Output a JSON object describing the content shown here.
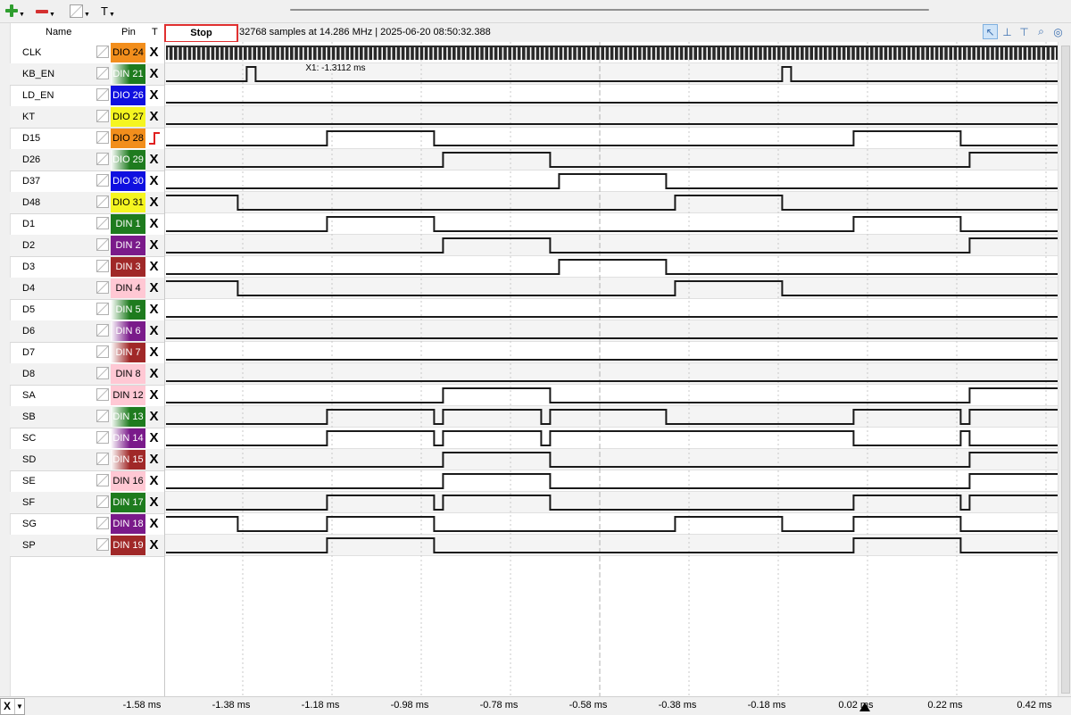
{
  "toolbar": {
    "add_icon": "plus-icon",
    "remove_icon": "minus-icon",
    "decoder_icon": "decoder-icon",
    "text_icon_label": "T"
  },
  "columns": {
    "name": "Name",
    "pin": "Pin",
    "trigger": "T"
  },
  "header": {
    "stop_label": "Stop",
    "info": "32768 samples at 14.286 MHz | 2025-06-20 08:50:32.388"
  },
  "cursor": {
    "label": "X1: -1.3112 ms",
    "time_ms": -1.3112
  },
  "time_axis": {
    "start_ms": -1.58,
    "ms_per_div": 0.2,
    "ticks": [
      "-1.58 ms",
      "-1.38 ms",
      "-1.18 ms",
      "-0.98 ms",
      "-0.78 ms",
      "-0.58 ms",
      "-0.38 ms",
      "-0.18 ms",
      "0.02 ms",
      "0.22 ms",
      "0.42 ms"
    ]
  },
  "x_selector": "X",
  "signals": [
    {
      "name": "CLK",
      "pin": "DIO 24",
      "pin_colors": [
        "#f28e1c",
        "#f28e1c"
      ],
      "pin_text": "#000",
      "trigger": "X",
      "clock": true,
      "init": 1,
      "edges": []
    },
    {
      "name": "KB_EN",
      "pin": "DIN 21",
      "pin_colors": [
        "#ffffff",
        "#1e7b1e"
      ],
      "pin_text": "#fff",
      "trigger": "X",
      "init": 0,
      "edges": [
        -1.3712,
        -1.3512,
        -0.1712,
        -0.1512
      ]
    },
    {
      "name": "LD_EN",
      "pin": "DIO 26",
      "pin_colors": [
        "#1010e0",
        "#1010e0"
      ],
      "pin_text": "#fff",
      "trigger": "X",
      "init": 0,
      "edges": []
    },
    {
      "name": "KT",
      "pin": "DIO 27",
      "pin_colors": [
        "#f5f520",
        "#f5f520"
      ],
      "pin_text": "#000",
      "trigger": "X",
      "init": 0,
      "edges": []
    },
    {
      "name": "D15",
      "pin": "DIO 28",
      "pin_colors": [
        "#f28e1c",
        "#f28e1c"
      ],
      "pin_text": "#000",
      "trigger": "rise",
      "init": 0,
      "edges": [
        -1.1912,
        -0.9512,
        -0.0112,
        0.2288
      ]
    },
    {
      "name": "D26",
      "pin": "DIO 29",
      "pin_colors": [
        "#ffffff",
        "#1e7b1e"
      ],
      "pin_text": "#fff",
      "trigger": "X",
      "init": 0,
      "edges": [
        -0.9312,
        -0.6912,
        0.2488
      ]
    },
    {
      "name": "D37",
      "pin": "DIO 30",
      "pin_colors": [
        "#1010e0",
        "#1010e0"
      ],
      "pin_text": "#fff",
      "trigger": "X",
      "init": 0,
      "edges": [
        -0.6712,
        -0.4312
      ]
    },
    {
      "name": "D48",
      "pin": "DIO 31",
      "pin_colors": [
        "#f5f520",
        "#f5f520"
      ],
      "pin_text": "#000",
      "trigger": "X",
      "init": 1,
      "edges": [
        -1.3912,
        -0.4112,
        -0.1712
      ]
    },
    {
      "name": "D1",
      "pin": "DIN  1",
      "pin_colors": [
        "#1e7b1e",
        "#1e7b1e"
      ],
      "pin_text": "#fff",
      "trigger": "X",
      "init": 0,
      "edges": [
        -1.1912,
        -0.9512,
        -0.0112,
        0.2288
      ]
    },
    {
      "name": "D2",
      "pin": "DIN  2",
      "pin_colors": [
        "#7a1a8a",
        "#7a1a8a"
      ],
      "pin_text": "#fff",
      "trigger": "X",
      "init": 0,
      "edges": [
        -0.9312,
        -0.6912,
        0.2488
      ]
    },
    {
      "name": "D3",
      "pin": "DIN  3",
      "pin_colors": [
        "#a02828",
        "#a02828"
      ],
      "pin_text": "#fff",
      "trigger": "X",
      "init": 0,
      "edges": [
        -0.6712,
        -0.4312
      ]
    },
    {
      "name": "D4",
      "pin": "DIN  4",
      "pin_colors": [
        "#ffc8d4",
        "#ffc8d4"
      ],
      "pin_text": "#000",
      "trigger": "X",
      "init": 1,
      "edges": [
        -1.3912,
        -0.4112,
        -0.1712
      ]
    },
    {
      "name": "D5",
      "pin": "DIN  5",
      "pin_colors": [
        "#ffffff",
        "#1e7b1e"
      ],
      "pin_text": "#fff",
      "trigger": "X",
      "init": 0,
      "edges": []
    },
    {
      "name": "D6",
      "pin": "DIN  6",
      "pin_colors": [
        "#ffffff",
        "#7a1a8a"
      ],
      "pin_text": "#fff",
      "trigger": "X",
      "init": 0,
      "edges": []
    },
    {
      "name": "D7",
      "pin": "DIN  7",
      "pin_colors": [
        "#ffffff",
        "#a02828"
      ],
      "pin_text": "#fff",
      "trigger": "X",
      "init": 0,
      "edges": []
    },
    {
      "name": "D8",
      "pin": "DIN  8",
      "pin_colors": [
        "#ffc8d4",
        "#ffc8d4"
      ],
      "pin_text": "#000",
      "trigger": "X",
      "init": 0,
      "edges": []
    },
    {
      "name": "SA",
      "pin": "DIN 12",
      "pin_colors": [
        "#ffc8d4",
        "#ffc8d4"
      ],
      "pin_text": "#000",
      "trigger": "X",
      "init": 0,
      "edges": [
        -0.9312,
        -0.6912,
        0.2488
      ]
    },
    {
      "name": "SB",
      "pin": "DIN 13",
      "pin_colors": [
        "#ffffff",
        "#1e7b1e"
      ],
      "pin_text": "#fff",
      "trigger": "X",
      "init": 0,
      "edges": [
        -1.1912,
        -0.9512,
        -0.9312,
        -0.7112,
        -0.6912,
        -0.4312,
        -0.0112,
        0.2288,
        0.2488
      ]
    },
    {
      "name": "SC",
      "pin": "DIN 14",
      "pin_colors": [
        "#ffffff",
        "#7a1a8a"
      ],
      "pin_text": "#fff",
      "trigger": "X",
      "init": 0,
      "edges": [
        -1.1912,
        -0.9512,
        -0.9312,
        -0.7112,
        -0.6912,
        -0.0112,
        0.2288,
        0.2488
      ]
    },
    {
      "name": "SD",
      "pin": "DIN 15",
      "pin_colors": [
        "#ffffff",
        "#a02828"
      ],
      "pin_text": "#fff",
      "trigger": "X",
      "init": 0,
      "edges": [
        -0.9312,
        -0.6912,
        0.2488
      ]
    },
    {
      "name": "SE",
      "pin": "DIN 16",
      "pin_colors": [
        "#ffc8d4",
        "#ffc8d4"
      ],
      "pin_text": "#000",
      "trigger": "X",
      "init": 0,
      "edges": [
        -0.9312,
        -0.6912,
        0.2488
      ]
    },
    {
      "name": "SF",
      "pin": "DIN 17",
      "pin_colors": [
        "#1e7b1e",
        "#1e7b1e"
      ],
      "pin_text": "#fff",
      "trigger": "X",
      "init": 0,
      "edges": [
        -1.1912,
        -0.9512,
        -0.9312,
        -0.6912,
        -0.0112,
        0.2288,
        0.2488
      ]
    },
    {
      "name": "SG",
      "pin": "DIN 18",
      "pin_colors": [
        "#7a1a8a",
        "#7a1a8a"
      ],
      "pin_text": "#fff",
      "trigger": "X",
      "init": 1,
      "edges": [
        -1.3912,
        -1.1912,
        -0.9512,
        -0.4112,
        -0.1712,
        -0.0112,
        0.2288
      ]
    },
    {
      "name": "SP",
      "pin": "DIN 19",
      "pin_colors": [
        "#a02828",
        "#a02828"
      ],
      "pin_text": "#fff",
      "trigger": "X",
      "init": 0,
      "edges": [
        -1.1912,
        -0.9512,
        -0.0112,
        0.2288
      ]
    }
  ]
}
